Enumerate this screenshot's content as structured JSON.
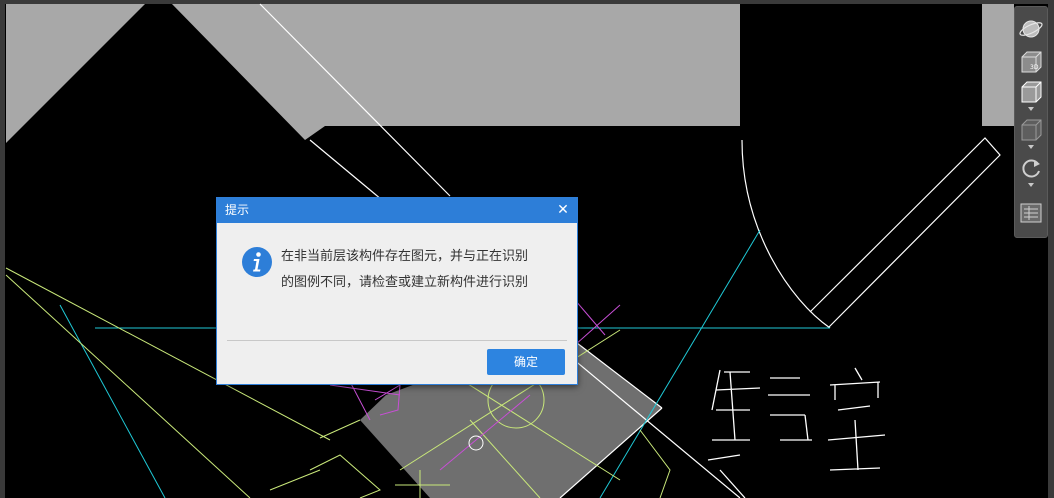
{
  "dialog": {
    "title": "提示",
    "close_glyph": "✕",
    "icon": "info-icon",
    "message_line1": "在非当前层该构件存在图元，并与正在识别",
    "message_line2": "的图例不同，请检查或建立新构件进行识别",
    "ok_label": "确定"
  },
  "view_toolbar": {
    "buttons": [
      {
        "icon": "orbit-icon"
      },
      {
        "icon": "3d-view-icon",
        "label": "3D"
      },
      {
        "icon": "box-view-icon"
      },
      {
        "icon": "shaded-box-icon"
      },
      {
        "icon": "rotate-icon"
      },
      {
        "icon": "properties-panel-icon"
      }
    ]
  },
  "canvas": {
    "background": "#000000",
    "handwritten_text": "集气室",
    "colors": {
      "gray_fill": "#a8a8a8",
      "cyan": "#1fc9d6",
      "yellow_green": "#c9e87a",
      "magenta": "#c84fd6",
      "white": "#ffffff"
    }
  }
}
